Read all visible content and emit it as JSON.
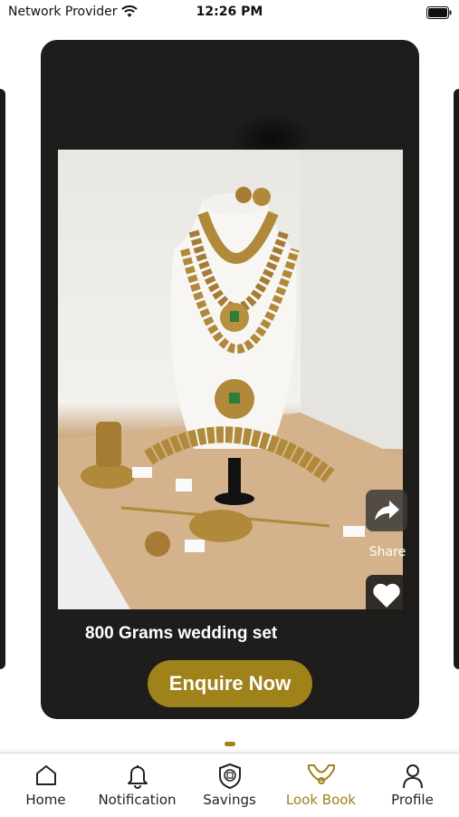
{
  "status_bar": {
    "carrier": "Network Provider",
    "time": "12:26 PM"
  },
  "card": {
    "title": "800 Grams wedding set",
    "enquire_label": "Enquire Now",
    "share_label": "Share"
  },
  "bottom_nav": {
    "items": [
      {
        "label": "Home",
        "icon": "home-icon",
        "active": false
      },
      {
        "label": "Notification",
        "icon": "bell-icon",
        "active": false
      },
      {
        "label": "Savings",
        "icon": "savings-icon",
        "active": false
      },
      {
        "label": "Look Book",
        "icon": "lookbook-icon",
        "active": true
      },
      {
        "label": "Profile",
        "icon": "person-icon",
        "active": false
      }
    ]
  },
  "colors": {
    "accent": "#a0821a",
    "card_bg": "#1e1d1b"
  }
}
